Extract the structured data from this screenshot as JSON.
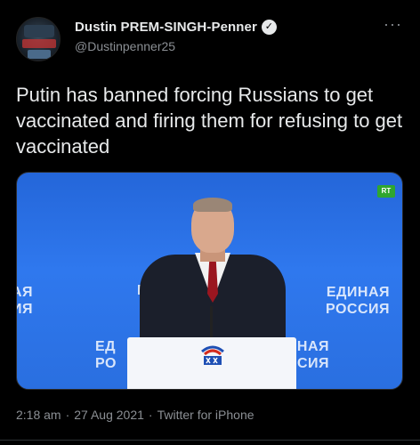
{
  "author": {
    "display_name": "Dustin PREM-SINGH-Penner",
    "handle": "@Dustinpenner25",
    "verified_glyph": "✓"
  },
  "more_glyph": "···",
  "tweet": {
    "text": "Putin has banned forcing Russians to get vaccinated and firing them for refusing to get vaccinated"
  },
  "media": {
    "badge": "RT",
    "backdrop_text_right": "ЕДИНАЯ\nРОССИЯ",
    "backdrop_text_left": "АЯ\nИЯ",
    "backdrop_text_bottom_left": "ЕД\nРО",
    "backdrop_text_bottom_right": "ИНАЯ\nССИЯ",
    "backdrop_text_mid": "Е",
    "colors": {
      "backdrop": "#2f78ee",
      "badge": "#2fa62f",
      "tie": "#9a1620"
    }
  },
  "meta": {
    "time": "2:18 am",
    "sep1": "·",
    "date": "27 Aug 2021",
    "sep2": "·",
    "source": "Twitter for iPhone"
  }
}
